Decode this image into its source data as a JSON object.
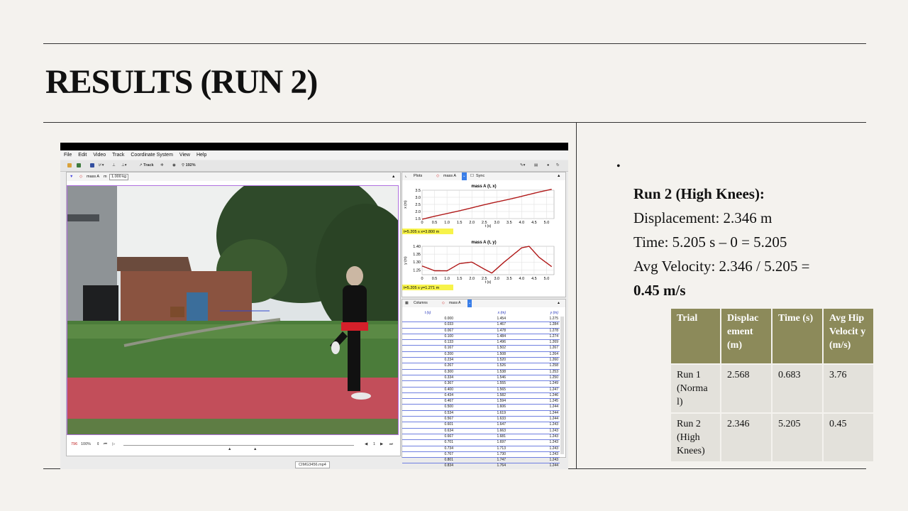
{
  "slide": {
    "title": "RESULTS (RUN 2)"
  },
  "tracker": {
    "menu": [
      "File",
      "Edit",
      "Video",
      "Track",
      "Coordinate System",
      "View",
      "Help"
    ],
    "toolbar": {
      "track_label": "Track",
      "zoom": "192%"
    },
    "video_head": {
      "mass_name": "mass A",
      "mass_unit": "m",
      "mass_value": "1.000 kg"
    },
    "video_foot": {
      "frame": "796",
      "zoom": "100%",
      "step": "1"
    },
    "filename": "CIMG3456.mp4",
    "plots": {
      "tab_label": "Plots",
      "track_label": "mass A",
      "sync_label": "Sync",
      "plot1": {
        "title": "mass A (t, x)",
        "ylabel": "x (m)",
        "xlabel": "t (s)",
        "readout": "t=5.205 s  x=3.800 m",
        "yticks": [
          "3.5",
          "3.0",
          "2.5",
          "2.0",
          "1.5"
        ],
        "xticks": [
          "0",
          "0.5",
          "1.0",
          "1.5",
          "2.0",
          "2.5",
          "3.0",
          "3.5",
          "4.0",
          "4.5",
          "5.0"
        ]
      },
      "plot2": {
        "title": "mass A (t, y)",
        "ylabel": "y (m)",
        "xlabel": "t (s)",
        "readout": "t=5.205 s  y=1.271 m",
        "yticks": [
          "1.40",
          "1.35",
          "1.30",
          "1.25"
        ],
        "xticks": [
          "0",
          "0.5",
          "1.0",
          "1.5",
          "2.0",
          "2.5",
          "3.0",
          "3.5",
          "4.0",
          "4.5",
          "5.0"
        ]
      }
    },
    "table": {
      "columns_label": "Columns",
      "track_label": "mass A",
      "headers": [
        "t (s)",
        "x (m)",
        "y (m)"
      ],
      "rows": [
        [
          "0.000",
          "1.454",
          "1.275"
        ],
        [
          "0.033",
          "1.467",
          "1.284"
        ],
        [
          "0.067",
          "1.478",
          "1.278"
        ],
        [
          "0.100",
          "1.484",
          "1.274"
        ],
        [
          "0.133",
          "1.496",
          "1.269"
        ],
        [
          "0.167",
          "1.502",
          "1.267"
        ],
        [
          "0.200",
          "1.508",
          "1.264"
        ],
        [
          "0.234",
          "1.520",
          "1.260"
        ],
        [
          "0.267",
          "1.526",
          "1.258"
        ],
        [
          "0.300",
          "1.538",
          "1.253"
        ],
        [
          "0.334",
          "1.546",
          "1.250"
        ],
        [
          "0.367",
          "1.555",
          "1.249"
        ],
        [
          "0.400",
          "1.565",
          "1.247"
        ],
        [
          "0.434",
          "1.582",
          "1.246"
        ],
        [
          "0.467",
          "1.594",
          "1.245"
        ],
        [
          "0.500",
          "1.606",
          "1.244"
        ],
        [
          "0.534",
          "1.619",
          "1.244"
        ],
        [
          "0.567",
          "1.633",
          "1.244"
        ],
        [
          "0.601",
          "1.647",
          "1.243"
        ],
        [
          "0.634",
          "1.663",
          "1.243"
        ],
        [
          "0.667",
          "1.681",
          "1.243"
        ],
        [
          "0.701",
          "1.697",
          "1.243"
        ],
        [
          "0.734",
          "1.713",
          "1.243"
        ],
        [
          "0.767",
          "1.730",
          "1.243"
        ],
        [
          "0.801",
          "1.747",
          "1.243"
        ],
        [
          "0.834",
          "1.764",
          "1.244"
        ]
      ]
    }
  },
  "summary": {
    "heading": "Run 2 (High Knees):",
    "displacement": "Displacement: 2.346 m",
    "time": "Time: 5.205 s – 0 = 5.205",
    "velocity": "Avg Velocity: 2.346 / 5.205 =",
    "result": "0.45 m/s"
  },
  "results_table": {
    "headers": [
      "Trial",
      "Displac ement (m)",
      "Time (s)",
      "Avg Hip Velocit y (m/s)"
    ],
    "rows": [
      [
        "Run 1 (Norma l)",
        "2.568",
        "0.683",
        "3.76"
      ],
      [
        "Run 2 (High Knees)",
        "2.346",
        "5.205",
        "0.45"
      ]
    ]
  },
  "colors": {
    "table_header": "#8c8a5a",
    "table_cell": "#e3e1db",
    "track_path": "#b01818"
  }
}
